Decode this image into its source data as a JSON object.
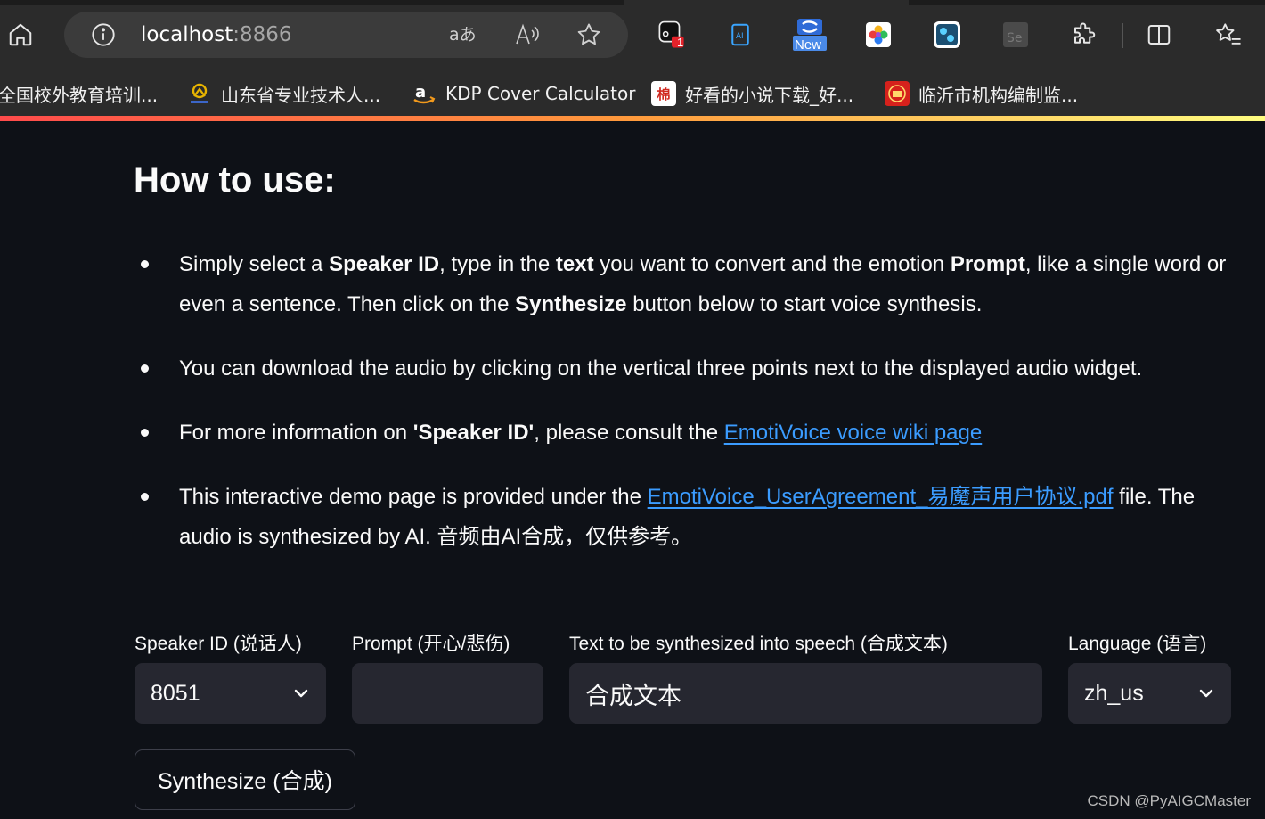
{
  "browser": {
    "url_host": "localhost",
    "url_port": ":8866",
    "extension_badge": "1",
    "extension_new_label": "New",
    "bookmarks": [
      {
        "label": "全国校外教育培训...",
        "icon": "education-icon"
      },
      {
        "label": "山东省专业技术人...",
        "icon": "shandong-logo-icon"
      },
      {
        "label": "KDP Cover Calculator",
        "icon": "amazon-icon"
      },
      {
        "label": "好看的小说下载_好...",
        "icon": "novel-icon",
        "glyph": "棉"
      },
      {
        "label": "临沂市机构编制监...",
        "icon": "government-icon"
      }
    ]
  },
  "page": {
    "heading": "How to use:",
    "bullet1": {
      "t1": "Simply select a ",
      "b1": "Speaker ID",
      "t2": ", type in the ",
      "b2": "text",
      "t3": " you want to convert and the emotion ",
      "b3": "Prompt",
      "t4": ", like a single word or even a sentence. Then click on the ",
      "b4": "Synthesize",
      "t5": " button below to start voice synthesis."
    },
    "bullet2": "You can download the audio by clicking on the vertical three points next to the displayed audio widget.",
    "bullet3": {
      "t1": "For more information on ",
      "b1": "'Speaker ID'",
      "t2": ", please consult the ",
      "link": "EmotiVoice voice wiki page"
    },
    "bullet4": {
      "t1": "This interactive demo page is provided under the ",
      "link": "EmotiVoice_UserAgreement_易魔声用户协议.pdf",
      "t2": " file. The audio is synthesized by AI. 音频由AI合成，仅供参考。"
    }
  },
  "form": {
    "speaker_label": "Speaker ID (说话人)",
    "speaker_value": "8051",
    "prompt_label": "Prompt (开心/悲伤)",
    "prompt_value": "",
    "text_label": "Text to be synthesized into speech (合成文本)",
    "text_value": "合成文本",
    "language_label": "Language (语言)",
    "language_value": "zh_us",
    "synthesize_label": "Synthesize (合成)"
  },
  "watermark": "CSDN @PyAIGCMaster",
  "colors": {
    "background": "#0e1117",
    "field": "#262730",
    "link": "#3b9cff",
    "toolbar": "#2b2b2b"
  }
}
